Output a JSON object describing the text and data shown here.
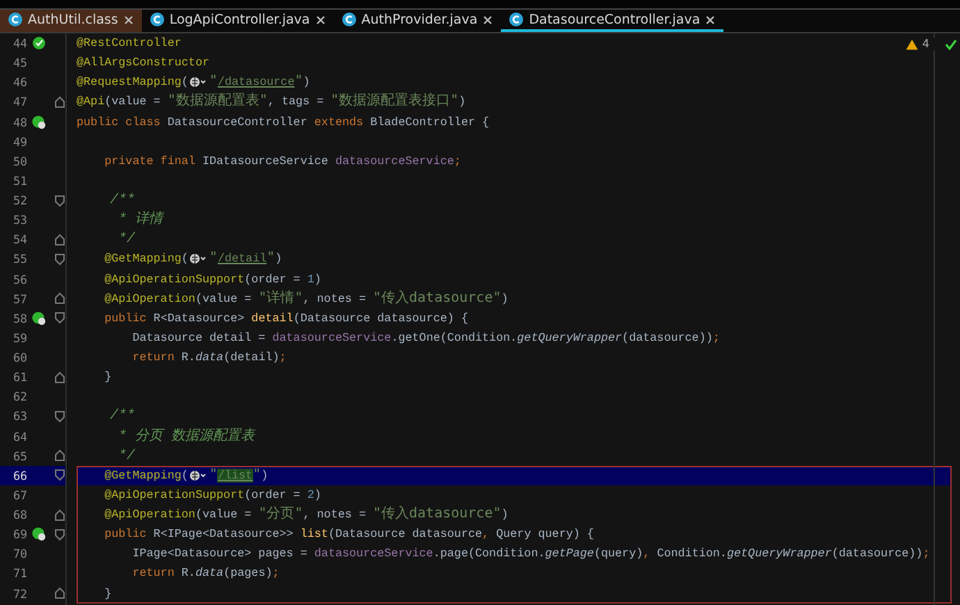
{
  "tabs": [
    {
      "label": "AuthUtil.class",
      "kind": "class",
      "selected": false
    },
    {
      "label": "LogApiController.java",
      "kind": "java",
      "selected": false
    },
    {
      "label": "AuthProvider.java",
      "kind": "java",
      "selected": false
    },
    {
      "label": "DatasourceController.java",
      "kind": "java",
      "selected": true
    }
  ],
  "inspections": [
    {
      "kind": "warning",
      "count": "4"
    },
    {
      "kind": "ok"
    }
  ],
  "lines": [
    {
      "number": "44",
      "gutter_marker": {
        "kind": "bean"
      },
      "current": false,
      "boxed": false,
      "tokens": [
        {
          "kind": "ann",
          "text": "@RestController"
        }
      ]
    },
    {
      "number": "45",
      "current": false,
      "boxed": false,
      "tokens": [
        {
          "kind": "ann",
          "text": "@AllArgsConstructor"
        }
      ]
    },
    {
      "number": "46",
      "current": false,
      "boxed": false,
      "tokens": [
        {
          "kind": "ann",
          "text": "@RequestMapping"
        },
        {
          "kind": "plain",
          "text": "("
        },
        {
          "kind": "globe"
        },
        {
          "kind": "str",
          "text": "\""
        },
        {
          "kind": "link",
          "text": "/datasource"
        },
        {
          "kind": "str",
          "text": "\""
        },
        {
          "kind": "plain",
          "text": ")"
        }
      ]
    },
    {
      "number": "47",
      "fold_marker": {
        "kind": "end"
      },
      "current": false,
      "boxed": false,
      "tokens": [
        {
          "kind": "ann",
          "text": "@Api"
        },
        {
          "kind": "plain",
          "text": "(value = "
        },
        {
          "kind": "str",
          "text": "\"数据源配置表\""
        },
        {
          "kind": "plain",
          "text": ", tags = "
        },
        {
          "kind": "str",
          "text": "\"数据源配置表接口\""
        },
        {
          "kind": "plain",
          "text": ")"
        }
      ]
    },
    {
      "number": "48",
      "gutter_marker": {
        "kind": "web"
      },
      "current": false,
      "boxed": false,
      "tokens": [
        {
          "kind": "kw",
          "text": "public class "
        },
        {
          "kind": "plain",
          "text": "DatasourceController "
        },
        {
          "kind": "kw",
          "text": "extends "
        },
        {
          "kind": "plain",
          "text": "BladeController {"
        }
      ]
    },
    {
      "number": "49",
      "current": false,
      "boxed": false
    },
    {
      "number": "50",
      "current": false,
      "boxed": false,
      "tokens": [
        {
          "kind": "kw",
          "text": "    private final "
        },
        {
          "kind": "plain",
          "text": "IDatasourceService "
        },
        {
          "kind": "field",
          "text": "datasourceService"
        },
        {
          "kind": "kw",
          "text": ";"
        }
      ]
    },
    {
      "number": "51",
      "current": false,
      "boxed": false
    },
    {
      "number": "52",
      "fold_marker": {
        "kind": "start"
      },
      "current": false,
      "boxed": false,
      "tokens": [
        {
          "kind": "comment",
          "text": "    /**"
        }
      ]
    },
    {
      "number": "53",
      "current": false,
      "boxed": false,
      "tokens": [
        {
          "kind": "comment",
          "text": "     * 详情"
        }
      ]
    },
    {
      "number": "54",
      "fold_marker": {
        "kind": "end"
      },
      "current": false,
      "boxed": false,
      "tokens": [
        {
          "kind": "comment",
          "text": "     */"
        }
      ]
    },
    {
      "number": "55",
      "fold_marker": {
        "kind": "start"
      },
      "current": false,
      "boxed": false,
      "tokens": [
        {
          "kind": "ann",
          "text": "    @GetMapping"
        },
        {
          "kind": "plain",
          "text": "("
        },
        {
          "kind": "globe"
        },
        {
          "kind": "str",
          "text": "\""
        },
        {
          "kind": "link",
          "text": "/detail"
        },
        {
          "kind": "str",
          "text": "\""
        },
        {
          "kind": "plain",
          "text": ")"
        }
      ]
    },
    {
      "number": "56",
      "current": false,
      "boxed": false,
      "tokens": [
        {
          "kind": "ann",
          "text": "    @ApiOperationSupport"
        },
        {
          "kind": "plain",
          "text": "(order = "
        },
        {
          "kind": "num",
          "text": "1"
        },
        {
          "kind": "plain",
          "text": ")"
        }
      ]
    },
    {
      "number": "57",
      "fold_marker": {
        "kind": "end"
      },
      "current": false,
      "boxed": false,
      "tokens": [
        {
          "kind": "ann",
          "text": "    @ApiOperation"
        },
        {
          "kind": "plain",
          "text": "(value = "
        },
        {
          "kind": "str",
          "text": "\"详情\""
        },
        {
          "kind": "plain",
          "text": ", notes = "
        },
        {
          "kind": "str",
          "text": "\"传入datasource\""
        },
        {
          "kind": "plain",
          "text": ")"
        }
      ]
    },
    {
      "number": "58",
      "gutter_marker": {
        "kind": "web"
      },
      "fold_marker": {
        "kind": "start"
      },
      "current": false,
      "boxed": false,
      "tokens": [
        {
          "kind": "kw",
          "text": "    public "
        },
        {
          "kind": "plain",
          "text": "R<Datasource> "
        },
        {
          "kind": "fn",
          "text": "detail"
        },
        {
          "kind": "plain",
          "text": "(Datasource datasource) {"
        }
      ]
    },
    {
      "number": "59",
      "current": false,
      "boxed": false,
      "tokens": [
        {
          "kind": "plain",
          "text": "        Datasource detail = "
        },
        {
          "kind": "field",
          "text": "datasourceService"
        },
        {
          "kind": "plain",
          "text": ".getOne(Condition."
        },
        {
          "kind": "static",
          "text": "getQueryWrapper"
        },
        {
          "kind": "plain",
          "text": "(datasource))"
        },
        {
          "kind": "kw",
          "text": ";"
        }
      ]
    },
    {
      "number": "60",
      "current": false,
      "boxed": false,
      "tokens": [
        {
          "kind": "kw",
          "text": "        return "
        },
        {
          "kind": "plain",
          "text": "R."
        },
        {
          "kind": "static",
          "text": "data"
        },
        {
          "kind": "plain",
          "text": "(detail)"
        },
        {
          "kind": "kw",
          "text": ";"
        }
      ]
    },
    {
      "number": "61",
      "fold_marker": {
        "kind": "end"
      },
      "current": false,
      "boxed": false,
      "tokens": [
        {
          "kind": "plain",
          "text": "    }"
        }
      ]
    },
    {
      "number": "62",
      "current": false,
      "boxed": false
    },
    {
      "number": "63",
      "fold_marker": {
        "kind": "start"
      },
      "current": false,
      "boxed": false,
      "tokens": [
        {
          "kind": "comment",
          "text": "    /**"
        }
      ]
    },
    {
      "number": "64",
      "current": false,
      "boxed": false,
      "tokens": [
        {
          "kind": "comment",
          "text": "     * 分页 数据源配置表"
        }
      ]
    },
    {
      "number": "65",
      "fold_marker": {
        "kind": "end"
      },
      "current": false,
      "boxed": false,
      "tokens": [
        {
          "kind": "comment",
          "text": "     */"
        }
      ]
    },
    {
      "number": "66",
      "fold_marker": {
        "kind": "start"
      },
      "current": true,
      "boxed": true,
      "tokens": [
        {
          "kind": "ann",
          "text": "    @GetMapping"
        },
        {
          "kind": "plain",
          "text": "("
        },
        {
          "kind": "globe"
        },
        {
          "kind": "str",
          "text": "\""
        },
        {
          "kind": "link-match",
          "text": "/list"
        },
        {
          "kind": "str",
          "text": "\""
        },
        {
          "kind": "plain",
          "text": ")"
        }
      ]
    },
    {
      "number": "67",
      "current": false,
      "boxed": true,
      "tokens": [
        {
          "kind": "ann",
          "text": "    @ApiOperationSupport"
        },
        {
          "kind": "plain",
          "text": "(order = "
        },
        {
          "kind": "num",
          "text": "2"
        },
        {
          "kind": "plain",
          "text": ")"
        }
      ]
    },
    {
      "number": "68",
      "fold_marker": {
        "kind": "end"
      },
      "current": false,
      "boxed": true,
      "tokens": [
        {
          "kind": "ann",
          "text": "    @ApiOperation"
        },
        {
          "kind": "plain",
          "text": "(value = "
        },
        {
          "kind": "str",
          "text": "\"分页\""
        },
        {
          "kind": "plain",
          "text": ", notes = "
        },
        {
          "kind": "str",
          "text": "\"传入datasource\""
        },
        {
          "kind": "plain",
          "text": ")"
        }
      ]
    },
    {
      "number": "69",
      "gutter_marker": {
        "kind": "web"
      },
      "fold_marker": {
        "kind": "start"
      },
      "current": false,
      "boxed": true,
      "tokens": [
        {
          "kind": "kw",
          "text": "    public "
        },
        {
          "kind": "plain",
          "text": "R<IPage<Datasource>> "
        },
        {
          "kind": "fn",
          "text": "list"
        },
        {
          "kind": "plain",
          "text": "(Datasource datasource"
        },
        {
          "kind": "kw",
          "text": ", "
        },
        {
          "kind": "plain",
          "text": "Query query) {"
        }
      ]
    },
    {
      "number": "70",
      "current": false,
      "boxed": true,
      "tokens": [
        {
          "kind": "plain",
          "text": "        IPage<Datasource> pages = "
        },
        {
          "kind": "field",
          "text": "datasourceService"
        },
        {
          "kind": "plain",
          "text": ".page(Condition."
        },
        {
          "kind": "static",
          "text": "getPage"
        },
        {
          "kind": "plain",
          "text": "(query)"
        },
        {
          "kind": "kw",
          "text": ", "
        },
        {
          "kind": "plain",
          "text": "Condition."
        },
        {
          "kind": "static",
          "text": "getQueryWrapper"
        },
        {
          "kind": "plain",
          "text": "(datasource))"
        },
        {
          "kind": "kw",
          "text": ";"
        }
      ]
    },
    {
      "number": "71",
      "current": false,
      "boxed": true,
      "tokens": [
        {
          "kind": "kw",
          "text": "        return "
        },
        {
          "kind": "plain",
          "text": "R."
        },
        {
          "kind": "static",
          "text": "data"
        },
        {
          "kind": "plain",
          "text": "(pages)"
        },
        {
          "kind": "kw",
          "text": ";"
        }
      ]
    },
    {
      "number": "72",
      "fold_marker": {
        "kind": "end"
      },
      "current": false,
      "boxed": true,
      "tokens": [
        {
          "kind": "plain",
          "text": "    }"
        }
      ]
    }
  ]
}
